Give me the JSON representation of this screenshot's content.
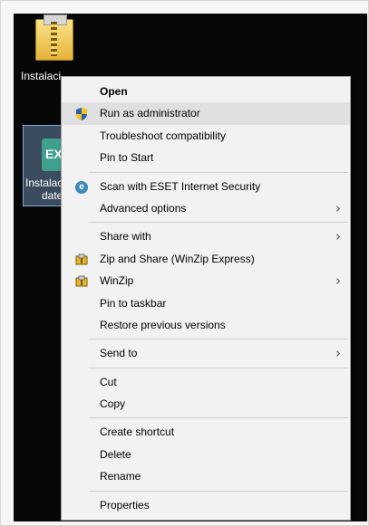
{
  "desktop": {
    "icon1_label": "Instalaci",
    "icon2_badge": "EXE",
    "icon2_label_line1": "Instalaci",
    "icon2_label_line2": "dateC"
  },
  "menu": {
    "items": [
      {
        "label": "Open",
        "bold": true,
        "icon": "",
        "submenu": false
      },
      {
        "label": "Run as administrator",
        "icon": "shield-icon",
        "highlighted": true,
        "submenu": false
      },
      {
        "label": "Troubleshoot compatibility",
        "icon": "",
        "submenu": false
      },
      {
        "label": "Pin to Start",
        "icon": "",
        "submenu": false
      },
      {
        "label": "Scan with ESET Internet Security",
        "icon": "eset-icon",
        "submenu": false
      },
      {
        "label": "Advanced options",
        "icon": "",
        "submenu": true
      },
      {
        "label": "Share with",
        "icon": "",
        "submenu": true
      },
      {
        "label": "Zip and Share (WinZip Express)",
        "icon": "winzip-icon",
        "submenu": false
      },
      {
        "label": "WinZip",
        "icon": "winzip-icon",
        "submenu": true
      },
      {
        "label": "Pin to taskbar",
        "icon": "",
        "submenu": false
      },
      {
        "label": "Restore previous versions",
        "icon": "",
        "submenu": false
      },
      {
        "label": "Send to",
        "icon": "",
        "submenu": true
      },
      {
        "label": "Cut",
        "icon": "",
        "submenu": false
      },
      {
        "label": "Copy",
        "icon": "",
        "submenu": false
      },
      {
        "label": "Create shortcut",
        "icon": "",
        "submenu": false
      },
      {
        "label": "Delete",
        "icon": "",
        "submenu": false
      },
      {
        "label": "Rename",
        "icon": "",
        "submenu": false
      },
      {
        "label": "Properties",
        "icon": "",
        "submenu": false
      }
    ],
    "chevron": "›",
    "eset_glyph": "e"
  },
  "colors": {
    "desktop": "#070707",
    "menu_bg": "#f2f2f2",
    "highlight": "#e0e0e0",
    "selection": "#7fa9cf"
  }
}
